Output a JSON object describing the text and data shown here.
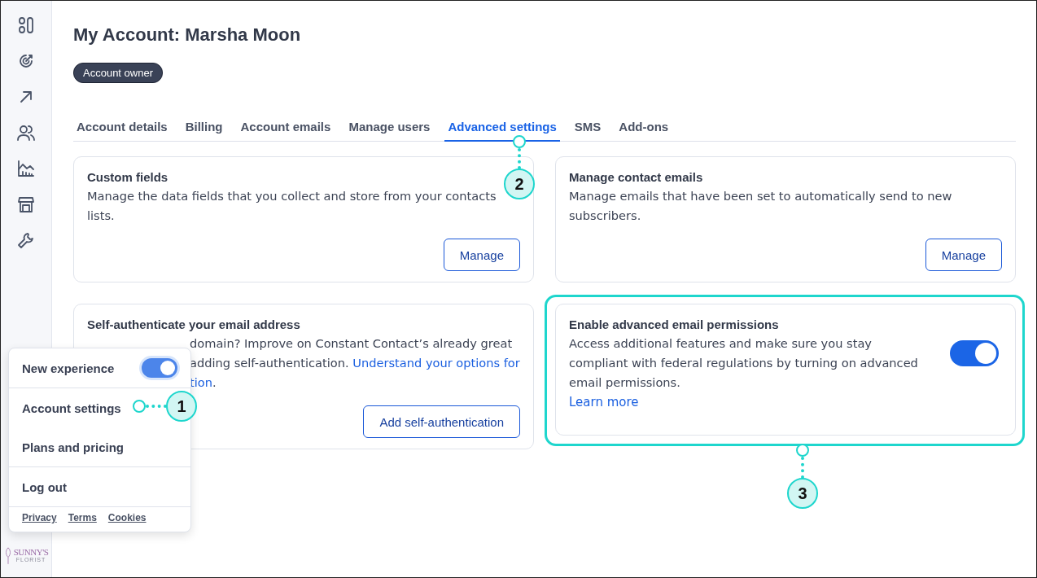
{
  "page": {
    "title": "My Account: Marsha Moon",
    "badge": "Account owner"
  },
  "tabs": [
    {
      "label": "Account details",
      "selected": false
    },
    {
      "label": "Billing",
      "selected": false
    },
    {
      "label": "Account emails",
      "selected": false
    },
    {
      "label": "Manage users",
      "selected": false
    },
    {
      "label": "Advanced settings",
      "selected": true
    },
    {
      "label": "SMS",
      "selected": false
    },
    {
      "label": "Add-ons",
      "selected": false
    }
  ],
  "cards": [
    {
      "kind": "button",
      "title": "Custom fields",
      "description": "Manage the data fields that you collect and store from your contacts lists.",
      "button": "Manage",
      "highlighted": false
    },
    {
      "kind": "button",
      "title": "Manage contact emails",
      "description": "Manage emails that have been set to automatically send to new subscribers.",
      "button": "Manage",
      "highlighted": false
    },
    {
      "kind": "button",
      "title": "Self-authenticate your email address",
      "lines": [
        [
          {
            "text": "domain? Improve on Constant Contact’s already great",
            "link": false
          }
        ],
        [
          {
            "text": "adding self-authentication. ",
            "link": false
          },
          {
            "text": "Understand your options for",
            "link": true
          }
        ],
        [
          {
            "text": "tion",
            "link": true
          },
          {
            "text": ".",
            "link": false
          }
        ]
      ],
      "button": "Add self-authentication",
      "highlighted": false
    },
    {
      "kind": "toggle",
      "title": "Enable advanced email permissions",
      "description": "Access additional features and make sure you stay compliant with federal regulations by turning on advanced email permissions.",
      "link": "Learn more",
      "on": true,
      "highlighted": true
    }
  ],
  "menu": {
    "sections": [
      [
        {
          "kind": "toggle",
          "label": "New experience",
          "on": true
        }
      ],
      [
        {
          "kind": "link",
          "label": "Account settings"
        },
        {
          "kind": "link",
          "label": "Plans and pricing"
        }
      ],
      [
        {
          "kind": "link",
          "label": "Log out"
        }
      ]
    ],
    "footer_links": [
      "Privacy",
      "Terms",
      "Cookies"
    ]
  },
  "logo": {
    "lines": [
      "SUNNY'S",
      "FLORIST"
    ]
  },
  "callouts": [
    {
      "number": "1"
    },
    {
      "number": "2"
    },
    {
      "number": "3"
    }
  ]
}
